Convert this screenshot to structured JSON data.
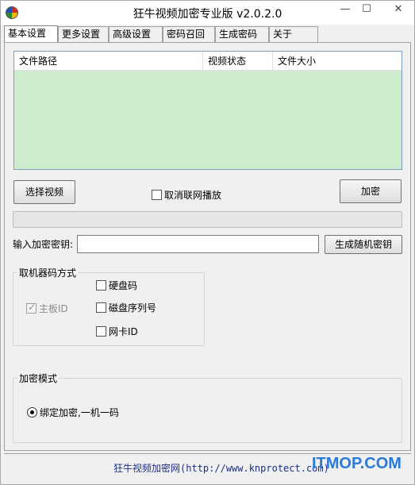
{
  "window": {
    "title": "狂牛视频加密专业版 v2.0.2.0",
    "minimize": "—",
    "maximize": "☐",
    "close": "✕"
  },
  "tabs": [
    {
      "label": "基本设置",
      "active": true
    },
    {
      "label": "更多设置"
    },
    {
      "label": "高级设置"
    },
    {
      "label": "密码召回"
    },
    {
      "label": "生成密码"
    },
    {
      "label": "关于"
    }
  ],
  "file_list": {
    "columns": [
      "文件路径",
      "视频状态",
      "文件大小"
    ],
    "rows": [],
    "background": "#cdeccd"
  },
  "buttons": {
    "select_video": "选择视频",
    "encrypt": "加密",
    "generate_key": "生成随机密钥"
  },
  "options": {
    "cancel_network_play": "取消联网播放"
  },
  "key": {
    "label": "输入加密密钥:",
    "value": ""
  },
  "machine_code": {
    "title": "取机器码方式",
    "mainboard": "主板ID",
    "disk_code": "硬盘码",
    "disk_serial": "磁盘序列号",
    "nic": "网卡ID"
  },
  "encrypt_mode": {
    "title": "加密模式",
    "option": "绑定加密,一机一码"
  },
  "footer": {
    "site_name": "狂牛视频加密网",
    "url": "(http://www.knprotect.com)"
  },
  "watermark": "ITMOP.COM"
}
